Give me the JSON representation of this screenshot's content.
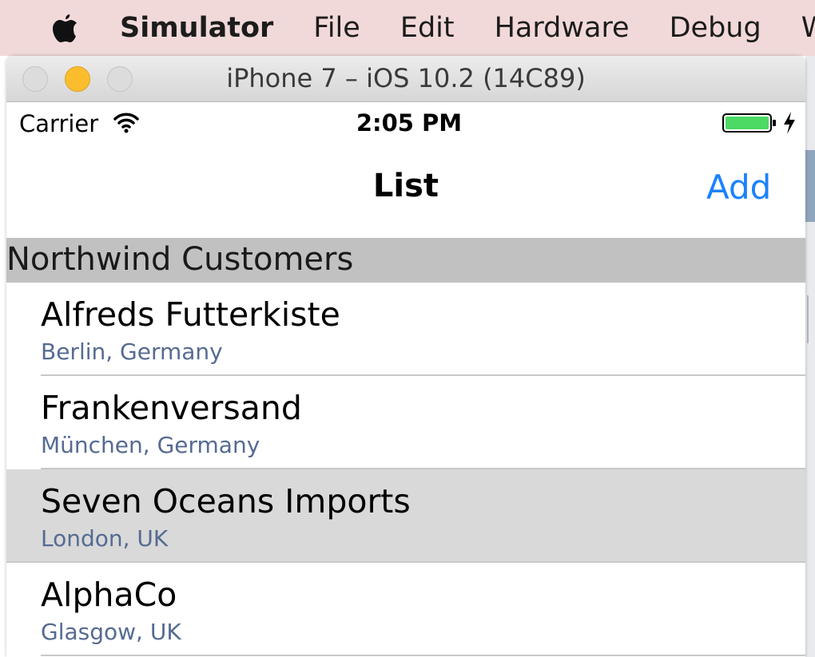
{
  "menubar": {
    "apple_icon": "apple-logo-icon",
    "items": [
      "Simulator",
      "File",
      "Edit",
      "Hardware",
      "Debug",
      "W"
    ]
  },
  "window": {
    "title": "iPhone 7 – iOS 10.2 (14C89)"
  },
  "status_bar": {
    "carrier": "Carrier",
    "wifi_icon": "wifi-icon",
    "time": "2:05 PM",
    "battery_icon": "battery-charging-icon",
    "battery_color": "#4cd964"
  },
  "nav_bar": {
    "title": "List",
    "add_label": "Add",
    "tint_color": "#1a82fb"
  },
  "table": {
    "section_header": "Northwind Customers",
    "rows": [
      {
        "name": "Alfreds Futterkiste",
        "location": "Berlin, Germany",
        "selected": false
      },
      {
        "name": "Frankenversand",
        "location": "München, Germany",
        "selected": false
      },
      {
        "name": "Seven Oceans Imports",
        "location": "London, UK",
        "selected": true
      },
      {
        "name": "AlphaCo",
        "location": "Glasgow, UK",
        "selected": false
      }
    ]
  }
}
